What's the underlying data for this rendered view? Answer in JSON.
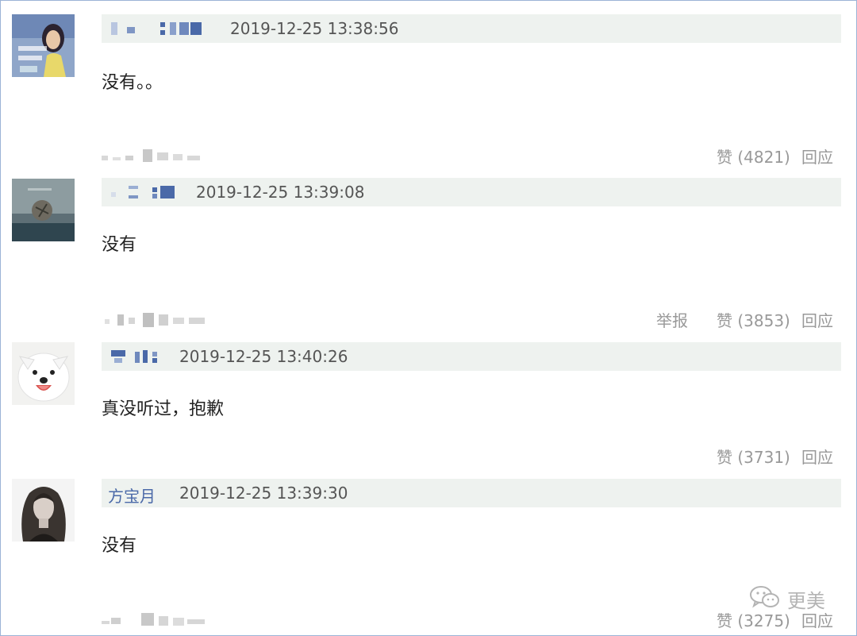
{
  "comments": [
    {
      "timestamp": "2019-12-25 13:38:56",
      "body": "没有。。",
      "actions": {
        "like": "赞 (4821)",
        "reply": "回应"
      }
    },
    {
      "timestamp": "2019-12-25 13:39:08",
      "body": "没有",
      "actions": {
        "report": "举报",
        "like": "赞 (3853)",
        "reply": "回应"
      }
    },
    {
      "timestamp": "2019-12-25 13:40:26",
      "body": "真没听过，抱歉",
      "actions": {
        "like": "赞 (3731)",
        "reply": "回应"
      }
    },
    {
      "username": "方宝月",
      "timestamp": "2019-12-25 13:39:30",
      "body": "没有",
      "actions": {
        "like": "赞 (3275)",
        "reply": "回应"
      }
    }
  ],
  "watermark": {
    "text": "更美",
    "icon": "wechat-icon"
  },
  "colors": {
    "username": "#4a69a8",
    "header_bg": "#eef2ef",
    "action": "#999999",
    "frame": "#9bb3d6"
  }
}
